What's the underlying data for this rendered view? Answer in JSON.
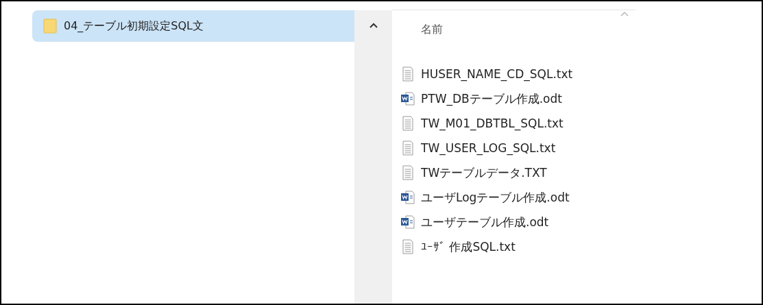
{
  "navigation_pane": {
    "items": [
      {
        "label": "04_テーブル初期設定SQL文",
        "selected": true
      }
    ]
  },
  "file_list": {
    "column_header": "名前",
    "files": [
      {
        "name": "HUSER_NAME_CD_SQL.txt",
        "kind": "text"
      },
      {
        "name": "PTW_DBテーブル作成.odt",
        "kind": "word"
      },
      {
        "name": "TW_M01_DBTBL_SQL.txt",
        "kind": "text"
      },
      {
        "name": "TW_USER_LOG_SQL.txt",
        "kind": "text"
      },
      {
        "name": "TWテーブルデータ.TXT",
        "kind": "text"
      },
      {
        "name": "ユーザLogテーブル作成.odt",
        "kind": "word"
      },
      {
        "name": "ユーザテーブル作成.odt",
        "kind": "word"
      },
      {
        "name": "ﾕｰｻﾞ 作成SQL.txt",
        "kind": "text"
      }
    ]
  }
}
